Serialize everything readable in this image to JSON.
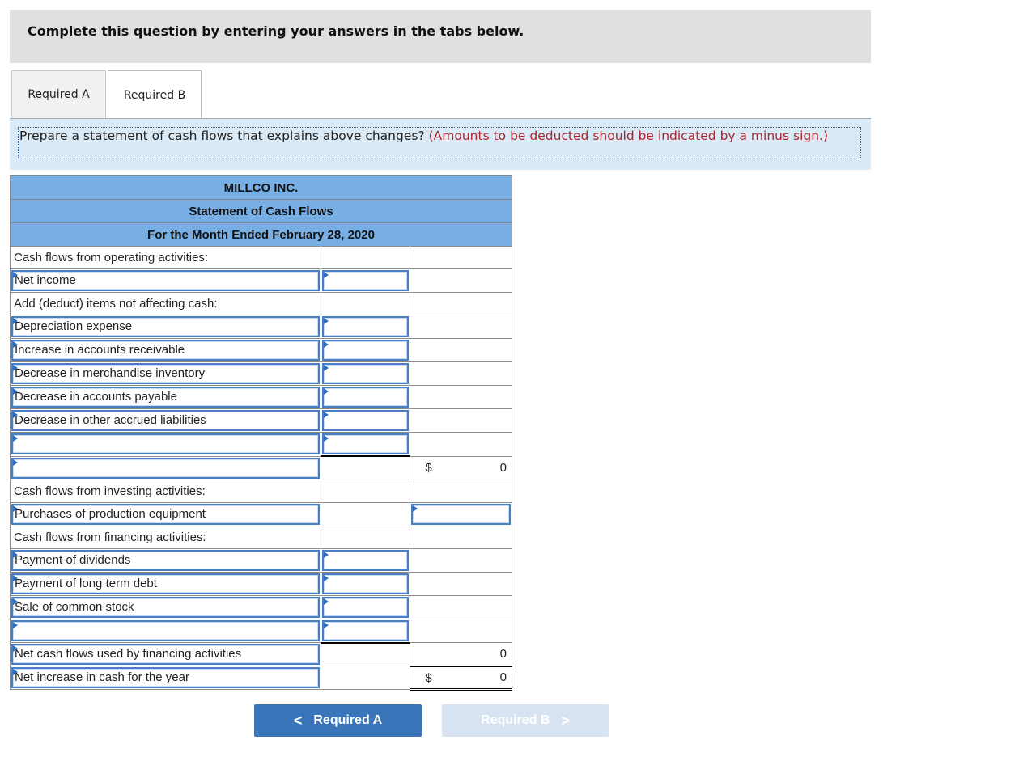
{
  "instruction": "Complete this question by entering your answers in the tabs below.",
  "tabs": [
    {
      "label": "Required A",
      "active": false
    },
    {
      "label": "Required B",
      "active": true
    }
  ],
  "prompt": {
    "text": "Prepare a statement of cash flows that explains above changes?",
    "note": "(Amounts to be deducted should be indicated by a minus sign.)"
  },
  "statement": {
    "company": "MILLCO INC.",
    "title": "Statement of Cash Flows",
    "period": "For the Month Ended February 28, 2020",
    "rows": {
      "operating_header": "Cash flows from operating activities:",
      "net_income": "Net income",
      "adjustments_header": "Add (deduct) items not affecting cash:",
      "depreciation": "Depreciation expense",
      "accounts_receivable": "Increase in accounts receivable",
      "merchandise_inventory": "Decrease in merchandise inventory",
      "accounts_payable": "Decrease in accounts payable",
      "accrued_liabilities": "Decrease in other accrued liabilities",
      "blank_operating": "",
      "operating_total_label": "",
      "investing_header": "Cash flows from investing activities:",
      "purchases_equipment": "Purchases of production equipment",
      "financing_header": "Cash flows from financing activities:",
      "dividends": "Payment of dividends",
      "long_term_debt": "Payment of long term debt",
      "common_stock": "Sale of common stock",
      "blank_financing": "",
      "financing_total": "Net cash flows used by financing activities",
      "net_increase": "Net increase in cash for the year"
    },
    "values": {
      "currency_symbol": "$",
      "operating_total": "0",
      "financing_total": "0",
      "net_increase": "0"
    }
  },
  "nav": {
    "prev_label": "Required A",
    "next_label": "Required B",
    "prev_icon": "chevron-left-icon",
    "next_icon": "chevron-right-icon",
    "prev_chevron": "<",
    "next_chevron": ">"
  }
}
